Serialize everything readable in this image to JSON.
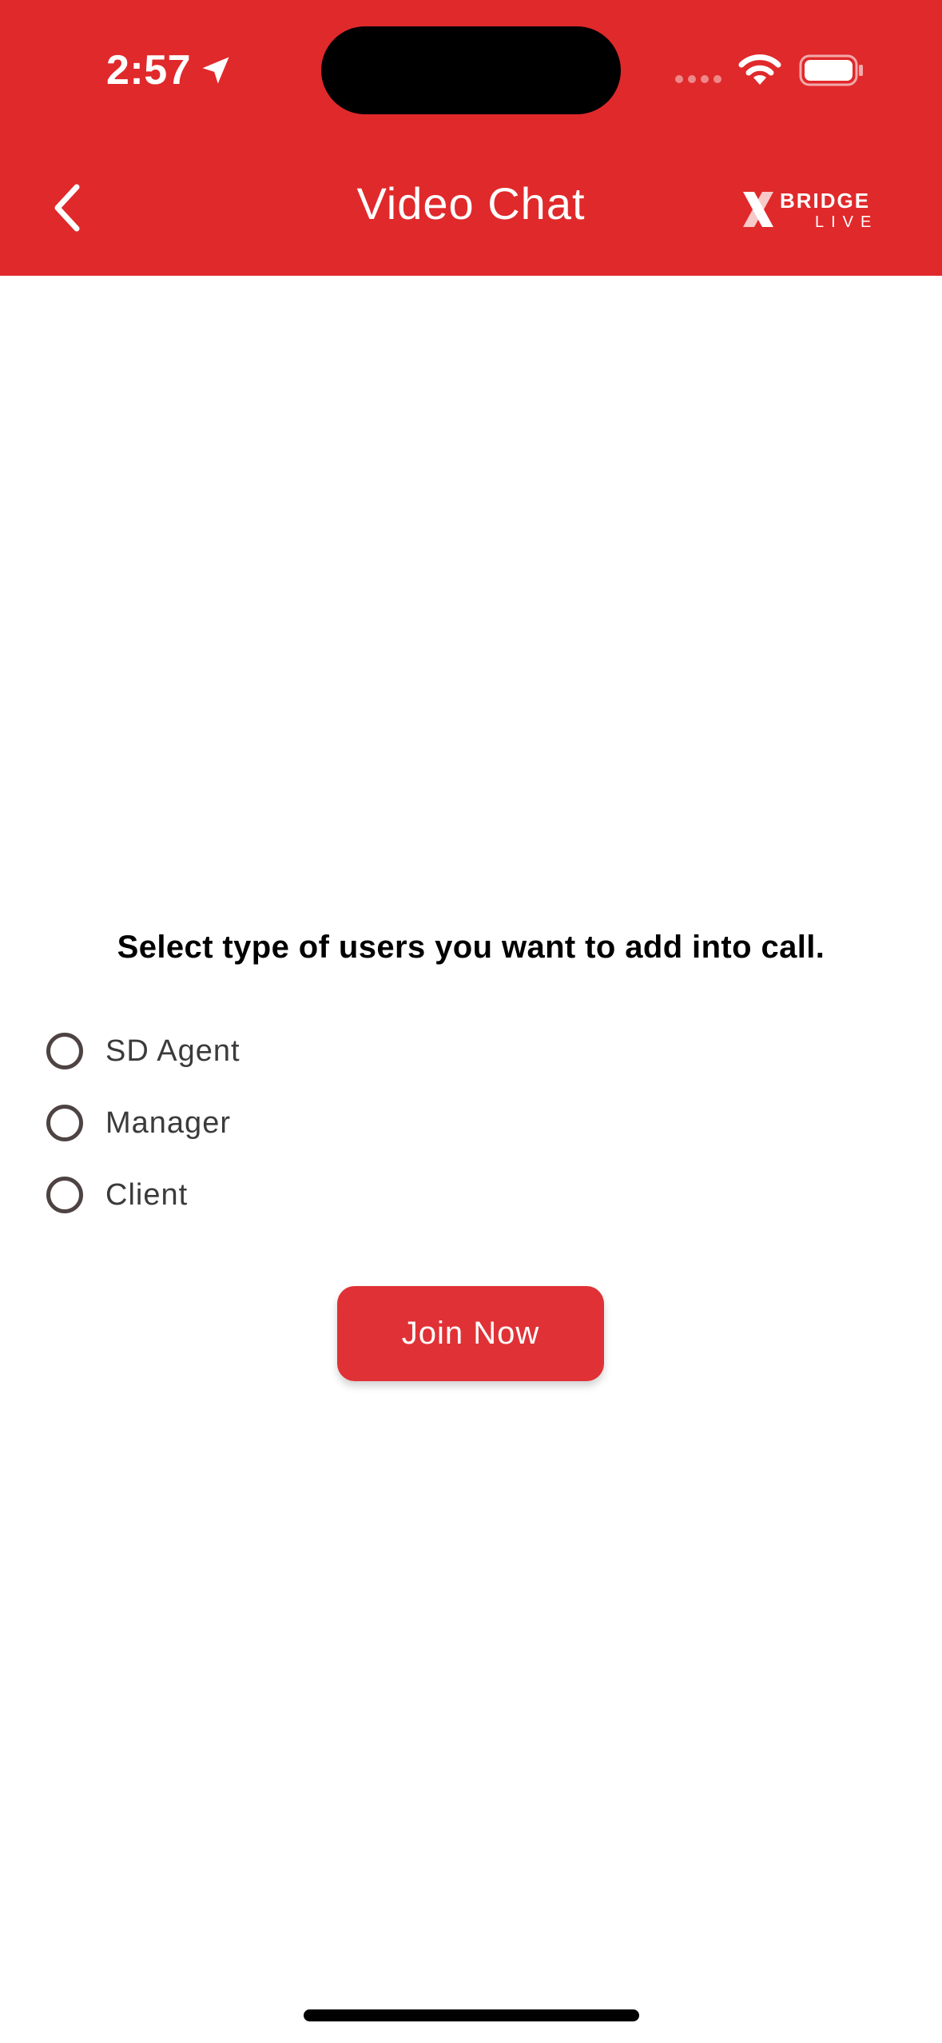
{
  "status_bar": {
    "time": "2:57"
  },
  "header": {
    "title": "Video Chat",
    "back_icon": "chevron-left-icon",
    "logo_text_top": "BRIDGE",
    "logo_text_bottom": "LIVE",
    "background_color": "#e0292b"
  },
  "main": {
    "prompt": "Select type of users you want to add into call.",
    "options": [
      {
        "label": "SD Agent",
        "selected": false
      },
      {
        "label": "Manager",
        "selected": false
      },
      {
        "label": "Client",
        "selected": false
      }
    ],
    "join_button_label": "Join Now",
    "accent_color": "#e03236"
  }
}
